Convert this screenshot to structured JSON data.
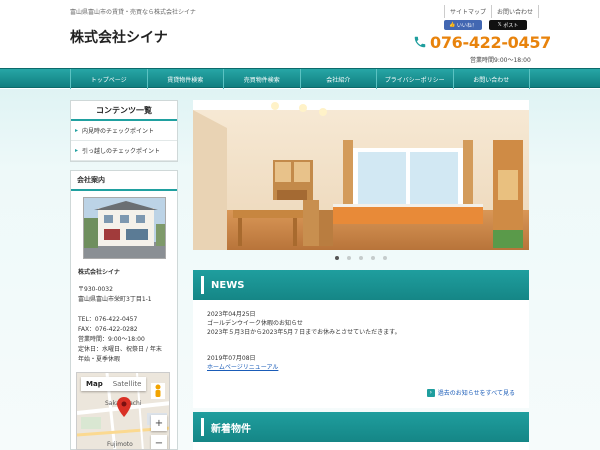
{
  "header": {
    "tagline": "富山県富山市の賃貸・売買なら株式会社シイナ",
    "company_name": "株式会社シイナ",
    "top_links": [
      "サイトマップ",
      "お問い合わせ"
    ],
    "fb_like": "いいね！",
    "x_post": "ポスト",
    "phone": "076-422-0457",
    "hours": "営業時間9:00～18:00"
  },
  "nav": {
    "items": [
      "トップページ",
      "賃貸物件検索",
      "売買物件検索",
      "会社紹介",
      "プライバシーポリシー",
      "お問い合わせ"
    ]
  },
  "sidebar": {
    "contents_title": "コンテンツ一覧",
    "links": [
      "内見時のチェックポイント",
      "引っ越しのチェックポイント"
    ],
    "company_title": "会社案内",
    "company_name": "株式会社シイナ",
    "zip": "〒930-0032",
    "address": "富山県富山市栄町3丁目1-1",
    "tel": "TEL：076-422-0457",
    "fax": "FAX：076-422-0282",
    "hours": "営業時間：9:00～18:00",
    "holiday_1": "定休日：水曜日、祝祭日 / 年末",
    "holiday_2": "年始・夏季休暇",
    "map_tab_map": "Map",
    "map_tab_sat": "Satellite",
    "map_label_1": "Sakaemachi",
    "map_label_2": "Fujimoto"
  },
  "slider": {
    "dots": 5,
    "active": 1
  },
  "news": {
    "title": "NEWS",
    "entries": [
      {
        "date": "2023年04月25日",
        "line1": "ゴールデンウイーク休暇のお知らせ",
        "line2": "2023年５月3日から2023年5月７日までお休みとさせていただきます。"
      },
      {
        "date": "2019年07月08日",
        "link": "ホームページリニューアル"
      }
    ],
    "more": "過去のお知らせをすべて見る"
  },
  "new_properties": {
    "title": "新着物件"
  },
  "colors": {
    "teal": "#1f9e9e",
    "orange": "#e8830c",
    "fb": "#4267b2"
  }
}
